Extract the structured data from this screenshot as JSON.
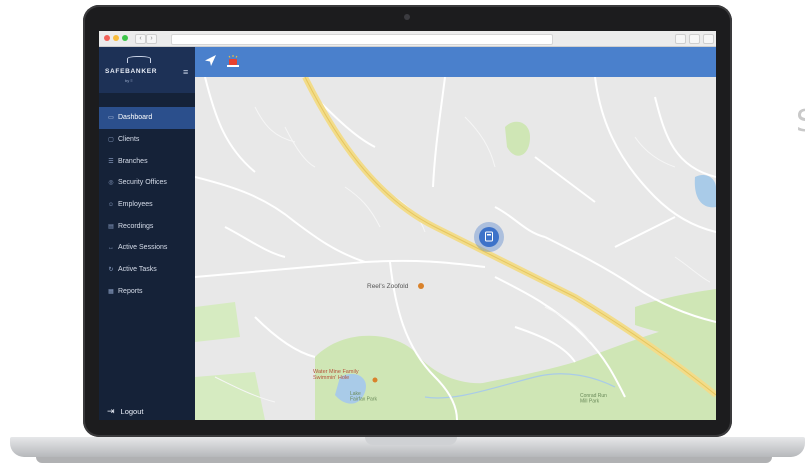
{
  "brand": {
    "name": "SAFEBANKER",
    "sub": "by ≡"
  },
  "sidebar": {
    "items": [
      {
        "label": "Dashboard",
        "icon": "dashboard-icon",
        "glyph": "▭",
        "active": true
      },
      {
        "label": "Clients",
        "icon": "clients-icon",
        "glyph": "▢",
        "active": false
      },
      {
        "label": "Branches",
        "icon": "branches-icon",
        "glyph": "☰",
        "active": false
      },
      {
        "label": "Security Offices",
        "icon": "security-office-icon",
        "glyph": "◎",
        "active": false
      },
      {
        "label": "Employees",
        "icon": "employees-icon",
        "glyph": "☺",
        "active": false
      },
      {
        "label": "Recordings",
        "icon": "recordings-icon",
        "glyph": "▤",
        "active": false
      },
      {
        "label": "Active Sessions",
        "icon": "sessions-icon",
        "glyph": "↔",
        "active": false
      },
      {
        "label": "Active Tasks",
        "icon": "tasks-icon",
        "glyph": "↻",
        "active": false
      },
      {
        "label": "Reports",
        "icon": "reports-icon",
        "glyph": "▦",
        "active": false
      }
    ],
    "logout": "Logout"
  },
  "map": {
    "labels": {
      "poi_zoo": "Reel's Zoofold",
      "poi_farm": "Water Mine Family\nSwimmin' Hole",
      "lake": "Lake\nFairfax Park",
      "park": "Conrad Run\nMill Park"
    }
  },
  "colors": {
    "sidebar": "#152238",
    "brand_bg": "#1d3156",
    "active": "#2b4f8c",
    "topbar": "#4a80cc",
    "map_bg": "#e8e8e8",
    "park": "#cfe6b5",
    "water": "#a9cbe8",
    "highway": "#f2dc8a",
    "marker": "#3d72c9"
  }
}
